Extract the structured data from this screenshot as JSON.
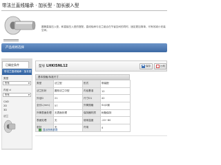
{
  "title": "带法兰直线轴承 · 加长型 · 加长嵌入型",
  "description": "圆筒直接压入型，和直接压入型的搭配，直线轴承与法兰组合在节省空间的同时，固定更加简单，可有效减小安装空间。",
  "header_bar": {
    "label": "产品规格选择"
  },
  "left_panel": {
    "tab_label": "已确定条件",
    "header": "带法兰直线轴承 · 加长型",
    "rows": [
      {
        "label": "类型",
        "value": "所有"
      },
      {
        "label": "内径 d",
        "value": "所有"
      },
      {
        "label": "CAD",
        "value": ""
      },
      {
        "label": "法兰",
        "value": ""
      }
    ],
    "cad_options": [
      "2D",
      "3D"
    ]
  },
  "codebar": {
    "label": "型号",
    "code": "LHKISNL12",
    "buttons": [
      {
        "label": "保存",
        "icon": "save-icon",
        "color": "#3a6db1"
      },
      {
        "label": "比较",
        "icon": "compare-icon",
        "color": "#d04a4a"
      }
    ]
  },
  "spec": {
    "title": "基本规格/标准尺寸",
    "rows": [
      [
        "类型",
        "法兰型",
        "形式",
        "带装配"
      ],
      [
        "法兰形状",
        "圆形法兰中型",
        "内径基准",
        "12"
      ],
      [
        "外径D",
        "21",
        "尺寸D1",
        "42"
      ],
      [
        "全长L(mm)",
        "57",
        "外筒规格",
        "SUJ2钢"
      ],
      [
        "外筒表面处理",
        "无表面处理",
        "保持器材质",
        "树脂保持"
      ],
      [
        "表面处理",
        "无",
        "使用温度",
        "-20~80"
      ],
      [
        "密封",
        "无",
        "许用",
        "4"
      ]
    ],
    "footer_link": "显示所有参数"
  }
}
